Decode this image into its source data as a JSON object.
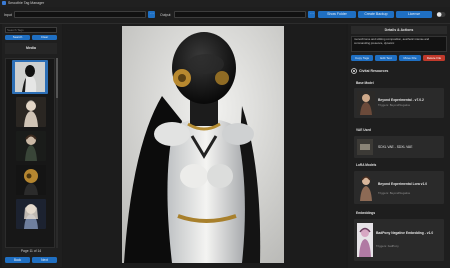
{
  "app": {
    "title": "Smoothie Tag Manager"
  },
  "toolbar": {
    "input_label": "Input",
    "input_value": "",
    "output_label": "Output",
    "output_value": "",
    "show_folder": "Show Folder",
    "create_backup": "Create Backup",
    "license": "License"
  },
  "left": {
    "search_placeholder": "Search Tags",
    "search_btn": "Search",
    "clear_btn": "Clear",
    "section_title": "Media",
    "page_indicator": "Page 11 of 14",
    "back_btn": "Back",
    "next_btn": "Next"
  },
  "right": {
    "details_title": "Details & Actions",
    "description": "monochrome and striking composition, aesthetic intense and commanding presence, dynamic",
    "copy_tags": "Copy Tags",
    "edit_text": "Edit Text",
    "move_file": "Move File",
    "delete_file": "Delete File",
    "civitai_title": "Civitai Resources",
    "base_model_heading": "Base Model",
    "base_model": {
      "name": "Beyond Experimental - v7.0.2",
      "sub": "Triggers: BeyondNegative"
    },
    "vae_heading": "VAE Used",
    "vae": {
      "name": "SDXL VAE - SDXL VAE"
    },
    "lora_heading": "LoRA Models",
    "lora": {
      "name": "Beyond Experimental Lora v1.0",
      "sub": "Triggers: BeyondNegative"
    },
    "emb_heading": "Embeddings",
    "embedding": {
      "name": "BadPony Negative Embedding - v1.0",
      "sub": "Triggers: badPony"
    }
  },
  "colors": {
    "accent": "#1f6fc2",
    "danger": "#c0392b",
    "panel": "#1f1f1f",
    "selection": "#2d6fb6"
  }
}
